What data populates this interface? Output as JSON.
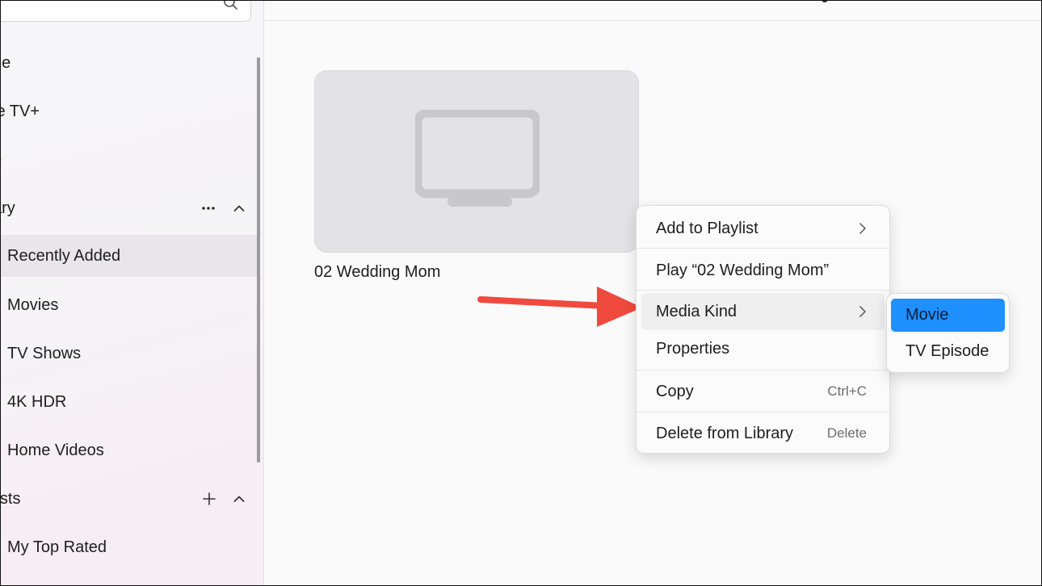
{
  "sidebar": {
    "items": [
      {
        "label": "Home",
        "visible_label": "ne"
      },
      {
        "label": "Apple TV+",
        "visible_label": "le TV+"
      },
      {
        "label": "Store",
        "visible_label": "e"
      },
      {
        "label": "Library",
        "visible_label": "ary"
      },
      {
        "label": "Recently Added"
      },
      {
        "label": "Movies"
      },
      {
        "label": "TV Shows"
      },
      {
        "label": "4K HDR"
      },
      {
        "label": "Home Videos"
      },
      {
        "label": "Playlists",
        "visible_label": "lists"
      },
      {
        "label": "My Top Rated"
      }
    ],
    "selected": "Recently Added"
  },
  "search": {
    "icon": "search-icon"
  },
  "library_section": {
    "more_icon": "ellipsis-icon",
    "collapse_icon": "chevron-up-icon"
  },
  "playlists_section": {
    "add_icon": "plus-icon",
    "collapse_icon": "chevron-up-icon"
  },
  "main": {
    "item": {
      "title": "02 Wedding Mom",
      "thumbnail_icon": "tv-icon"
    }
  },
  "context_menu": {
    "items": [
      {
        "label": "Add to Playlist",
        "has_submenu": true
      },
      {
        "label": "Play “02 Wedding Mom”"
      },
      {
        "label": "Media Kind",
        "has_submenu": true,
        "hovered": true
      },
      {
        "label": "Properties"
      },
      {
        "label": "Copy",
        "shortcut": "Ctrl+C"
      },
      {
        "label": "Delete from Library",
        "shortcut": "Delete"
      }
    ]
  },
  "submenu": {
    "items": [
      {
        "label": "Movie",
        "highlighted": true
      },
      {
        "label": "TV Episode"
      }
    ]
  },
  "colors": {
    "highlight": "#1e90ff",
    "annotation_arrow": "#f04a3e",
    "selected_row": "#e8e6ea"
  }
}
